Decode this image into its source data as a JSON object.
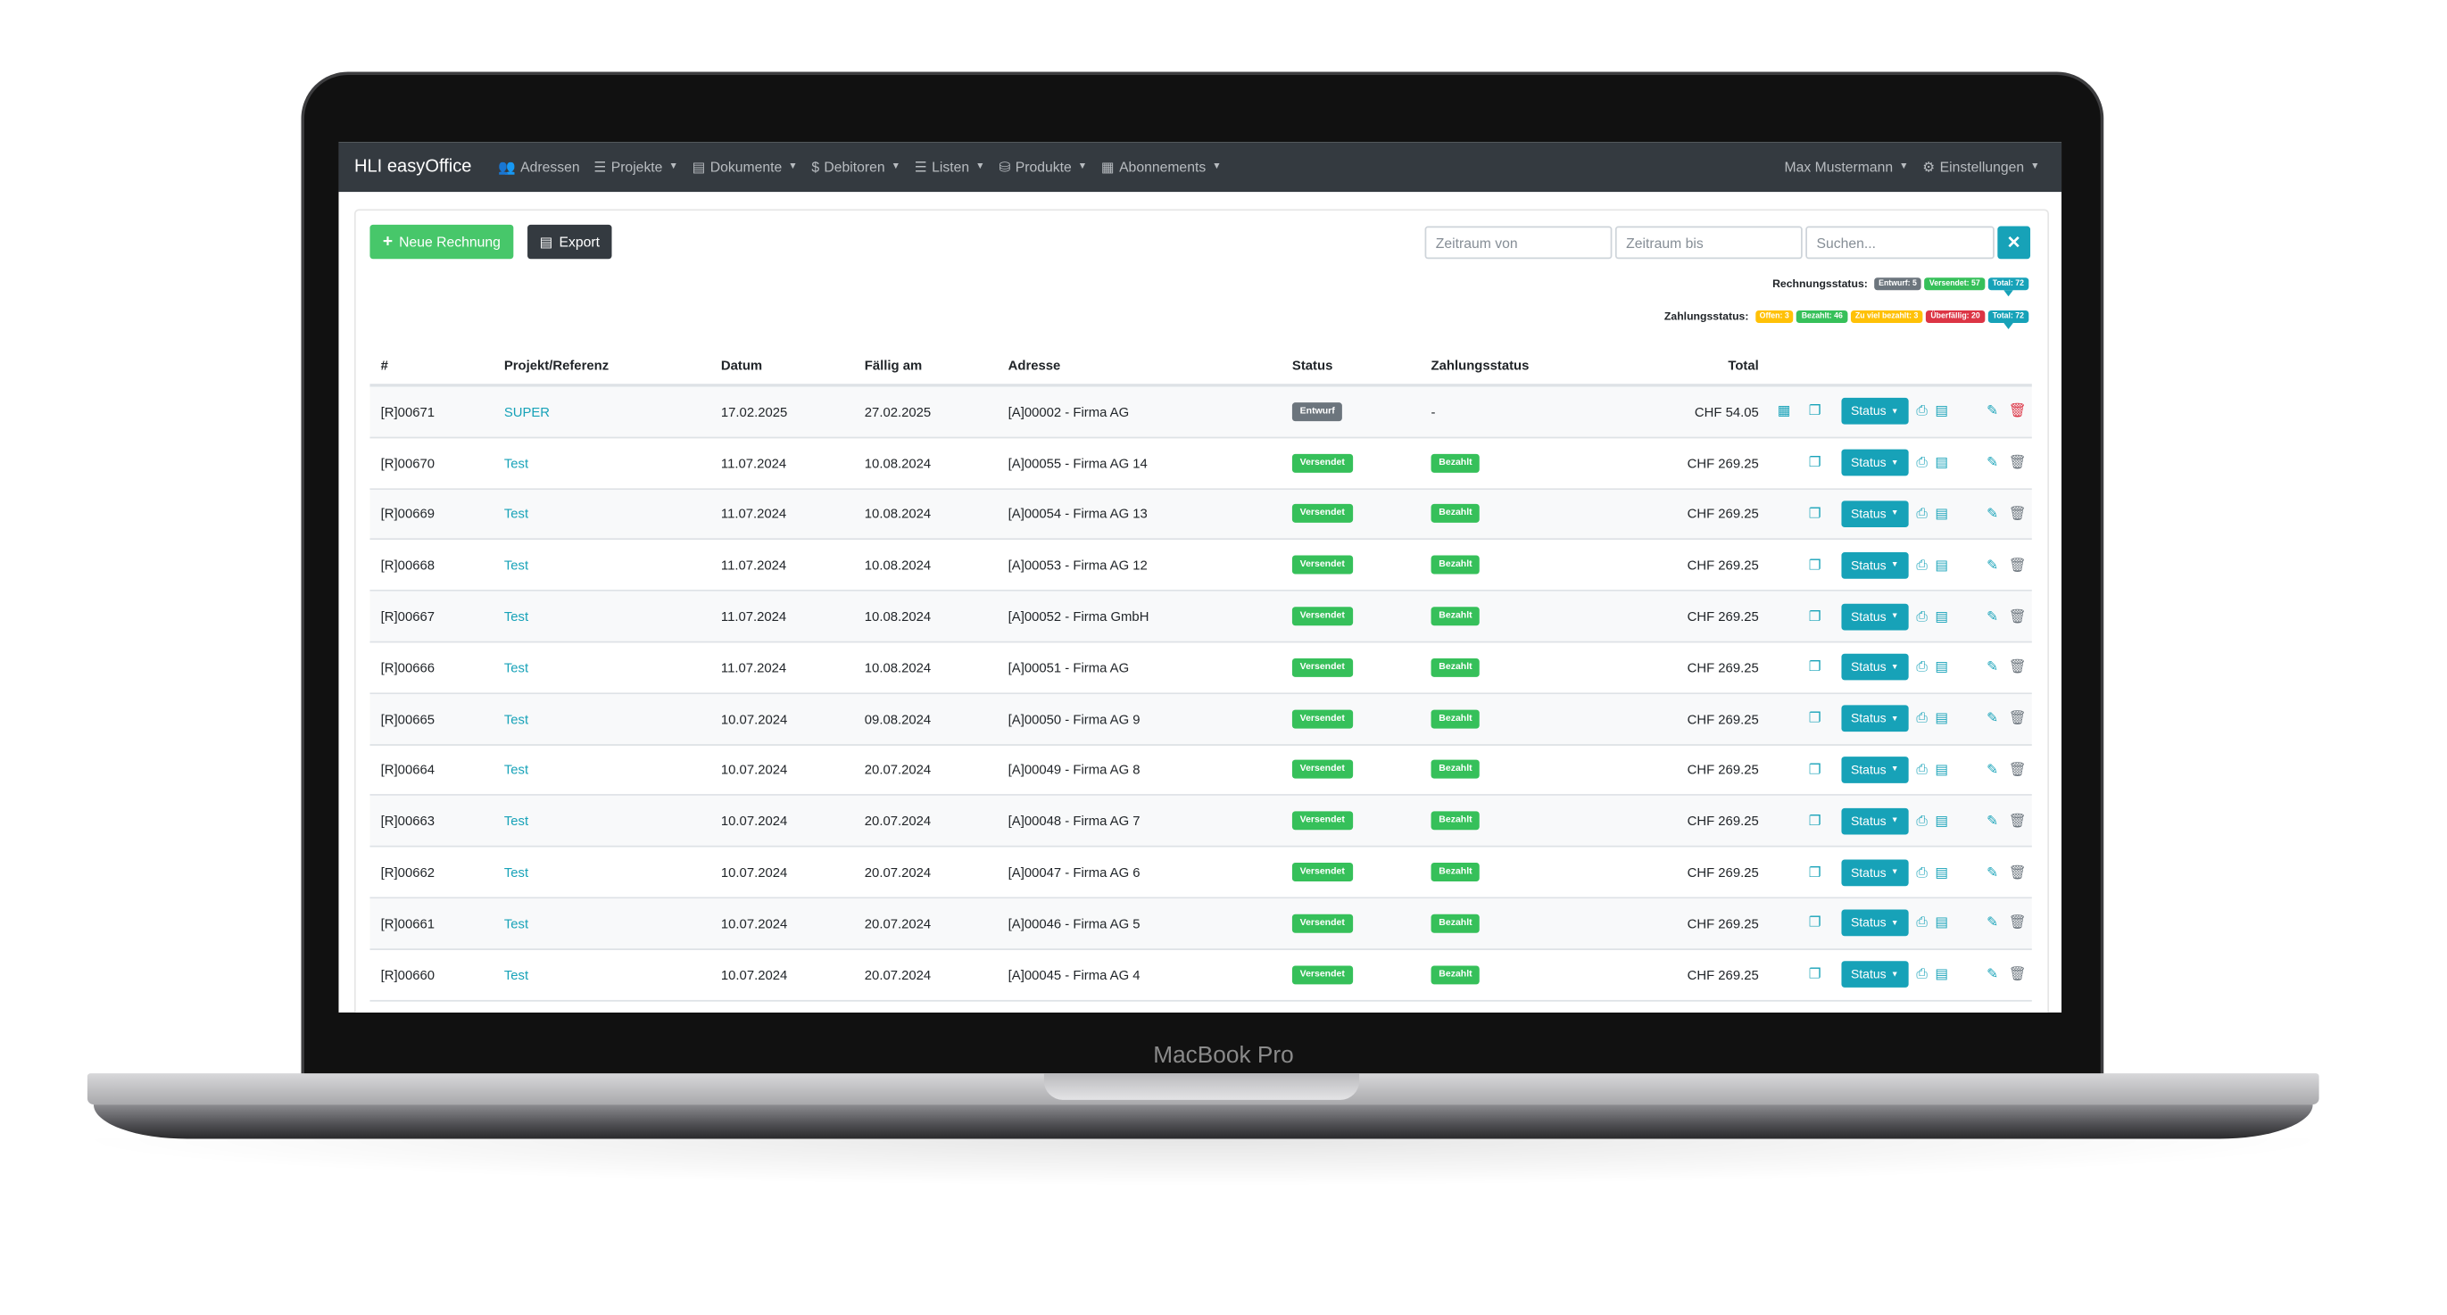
{
  "device": {
    "label": "MacBook Pro"
  },
  "navbar": {
    "brand": "HLI easyOffice",
    "items": [
      {
        "icon": "users-icon",
        "glyph": "👥",
        "label": "Adressen",
        "dropdown": false
      },
      {
        "icon": "list-icon",
        "glyph": "☰",
        "label": "Projekte",
        "dropdown": true
      },
      {
        "icon": "file-icon",
        "glyph": "▤",
        "label": "Dokumente",
        "dropdown": true
      },
      {
        "icon": "dollar-icon",
        "glyph": "$",
        "label": "Debitoren",
        "dropdown": true
      },
      {
        "icon": "list-icon",
        "glyph": "☰",
        "label": "Listen",
        "dropdown": true
      },
      {
        "icon": "basket-icon",
        "glyph": "⛁",
        "label": "Produkte",
        "dropdown": true
      },
      {
        "icon": "calendar-icon",
        "glyph": "▦",
        "label": "Abonnements",
        "dropdown": true
      }
    ],
    "user": "Max Mustermann",
    "settings": "Einstellungen",
    "settings_glyph": "⚙"
  },
  "toolbar": {
    "new_invoice": "Neue Rechnung",
    "new_invoice_glyph": "+",
    "export": "Export",
    "export_glyph": "▤",
    "date_from_placeholder": "Zeitraum von",
    "date_to_placeholder": "Zeitraum bis",
    "search_placeholder": "Suchen...",
    "clear_glyph": "✕"
  },
  "invoice_status": {
    "label": "Rechnungsstatus:",
    "tags": [
      {
        "text": "Entwurf: 5",
        "color": "#6c757d",
        "active": false
      },
      {
        "text": "Versendet: 57",
        "color": "#36c05a",
        "active": false
      },
      {
        "text": "Total: 72",
        "color": "#17a2b8",
        "active": true
      }
    ]
  },
  "payment_status": {
    "label": "Zahlungsstatus:",
    "tags": [
      {
        "text": "Offen: 3",
        "color": "#ffc107",
        "active": false
      },
      {
        "text": "Bezahlt: 46",
        "color": "#36c05a",
        "active": false
      },
      {
        "text": "Zu viel bezahlt: 3",
        "color": "#ffc107",
        "active": false
      },
      {
        "text": "Überfällig: 20",
        "color": "#dc3545",
        "active": false
      },
      {
        "text": "Total: 72",
        "color": "#17a2b8",
        "active": true
      }
    ]
  },
  "table": {
    "headers": [
      "#",
      "Projekt/Referenz",
      "Datum",
      "Fällig am",
      "Adresse",
      "Status",
      "Zahlungsstatus",
      "Total"
    ],
    "status_button": "Status",
    "rows": [
      {
        "id": "[R]00671",
        "ref": "SUPER",
        "date": "17.02.2025",
        "due": "27.02.2025",
        "address": "[A]00002 - Firma AG",
        "status": "Entwurf",
        "payment": "-",
        "total": "CHF 54.05"
      },
      {
        "id": "[R]00670",
        "ref": "Test",
        "date": "11.07.2024",
        "due": "10.08.2024",
        "address": "[A]00055 - Firma AG 14",
        "status": "Versendet",
        "payment": "Bezahlt",
        "total": "CHF 269.25"
      },
      {
        "id": "[R]00669",
        "ref": "Test",
        "date": "11.07.2024",
        "due": "10.08.2024",
        "address": "[A]00054 - Firma AG 13",
        "status": "Versendet",
        "payment": "Bezahlt",
        "total": "CHF 269.25"
      },
      {
        "id": "[R]00668",
        "ref": "Test",
        "date": "11.07.2024",
        "due": "10.08.2024",
        "address": "[A]00053 - Firma AG 12",
        "status": "Versendet",
        "payment": "Bezahlt",
        "total": "CHF 269.25"
      },
      {
        "id": "[R]00667",
        "ref": "Test",
        "date": "11.07.2024",
        "due": "10.08.2024",
        "address": "[A]00052 - Firma GmbH",
        "status": "Versendet",
        "payment": "Bezahlt",
        "total": "CHF 269.25"
      },
      {
        "id": "[R]00666",
        "ref": "Test",
        "date": "11.07.2024",
        "due": "10.08.2024",
        "address": "[A]00051 - Firma AG",
        "status": "Versendet",
        "payment": "Bezahlt",
        "total": "CHF 269.25"
      },
      {
        "id": "[R]00665",
        "ref": "Test",
        "date": "10.07.2024",
        "due": "09.08.2024",
        "address": "[A]00050 - Firma AG 9",
        "status": "Versendet",
        "payment": "Bezahlt",
        "total": "CHF 269.25"
      },
      {
        "id": "[R]00664",
        "ref": "Test",
        "date": "10.07.2024",
        "due": "20.07.2024",
        "address": "[A]00049 - Firma AG 8",
        "status": "Versendet",
        "payment": "Bezahlt",
        "total": "CHF 269.25"
      },
      {
        "id": "[R]00663",
        "ref": "Test",
        "date": "10.07.2024",
        "due": "20.07.2024",
        "address": "[A]00048 - Firma AG 7",
        "status": "Versendet",
        "payment": "Bezahlt",
        "total": "CHF 269.25"
      },
      {
        "id": "[R]00662",
        "ref": "Test",
        "date": "10.07.2024",
        "due": "20.07.2024",
        "address": "[A]00047 - Firma AG 6",
        "status": "Versendet",
        "payment": "Bezahlt",
        "total": "CHF 269.25"
      },
      {
        "id": "[R]00661",
        "ref": "Test",
        "date": "10.07.2024",
        "due": "20.07.2024",
        "address": "[A]00046 - Firma AG 5",
        "status": "Versendet",
        "payment": "Bezahlt",
        "total": "CHF 269.25"
      },
      {
        "id": "[R]00660",
        "ref": "Test",
        "date": "10.07.2024",
        "due": "20.07.2024",
        "address": "[A]00045 - Firma AG 4",
        "status": "Versendet",
        "payment": "Bezahlt",
        "total": "CHF 269.25"
      }
    ]
  }
}
